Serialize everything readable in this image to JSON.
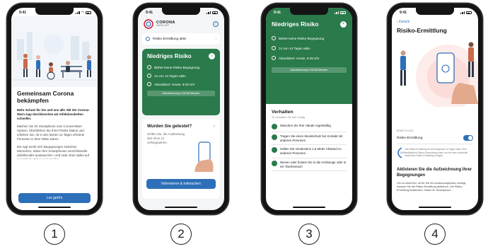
{
  "status_time": "9:41",
  "steps": [
    "1",
    "2",
    "3",
    "4"
  ],
  "screen1": {
    "title": "Gemeinsam Corona bekämpfen",
    "intro": "Mehr Schutz für Sie und uns alle. Mit der Corona-Warn-App durchbrechen wir Infektionsketten schneller.",
    "p1": "Machen Sie Ihr Smartphone zum Corona-Warn-System. Überblicken Sie Ihren Risiko-Status und erfahren Sie, ob in den letzten 14 Tagen infizierte Personen in Ihrer Nähe waren.",
    "p2": "Die App merkt sich Begegnungen zwischen Menschen, indem ihre Smartphones verschlüsselte Zufallscodes austauschen. Und zwar ohne dabei auf persönliche Daten zuzugreifen.",
    "button": "Los geht's"
  },
  "screen2": {
    "logo_title": "CORONA",
    "logo_sub": "WARN-APP",
    "tracing": "Risiko-Ermittlung aktiv",
    "risk_title": "Niedriges Risiko",
    "risk_items": [
      "Bisher keine Risiko-Begegnung",
      "14 von 14 Tagen aktiv",
      "Aktualisiert: Heute, 9:39 Uhr"
    ],
    "risk_update": "Aktualisierung in 58:08 Minuten",
    "test_title": "Wurden Sie getestet?",
    "test_text": "Helfen Sie, die Ausbreitung des Virus zu verlangsamen.",
    "test_button": "Informieren & mitmachen"
  },
  "screen3": {
    "risk_title": "Niedriges Risiko",
    "risk_items": [
      "Bisher keine Risiko-Begegnung",
      "14 von 14 Tagen aktiv",
      "Aktualisiert: Heute, 9:39 Uhr"
    ],
    "risk_update": "Aktualisierung in 58:08 Minuten",
    "behavior_title": "Verhalten",
    "behavior_sub": "So verhalten Sie sich richtig",
    "behavior_items": [
      "Waschen Sie Ihre Hände regelmäßig",
      "Tragen Sie einen Mundschutz bei Kontakt mit anderen Personen",
      "Halten Sie mindestens 1,5 Meter Abstand zu anderen Personen",
      "Niesen oder husten Sie in die Armbeuge oder in ein Taschentuch"
    ]
  },
  "screen4": {
    "back": "Zurück",
    "title": "Risiko-Ermittlung",
    "section": "ERMITTLUNG",
    "toggle_label": "Risiko-Ermittlung",
    "days": "14/14",
    "info": "Die Risiko-Ermittlung ist seit insgesamt 14 Tagen aktiv. Eine verlässliche Risiko-Überprüfung kann nur mit einer dauerhaft aktivierten Risiko-Ermittlung erfolgen.",
    "activate_title": "Aktivieren Sie die Aufzeichnung Ihrer Begegnungen",
    "activate_text": "Um zu erkennen, ob für Sie ein Ansteckungsrisiko vorliegt, müssen Sie die Risiko-Ermittlung aktivieren. Die Risiko-Ermittlung funktioniert, indem Ihr Smartphone..."
  }
}
